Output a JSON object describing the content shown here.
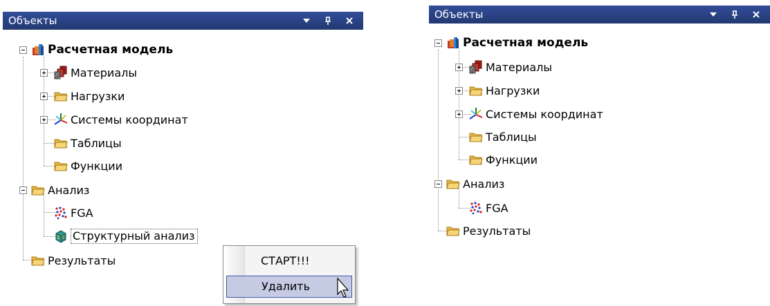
{
  "panels": [
    {
      "title": "Объекты",
      "tree": {
        "root": "Расчетная модель",
        "materials": "Материалы",
        "loads": "Нагрузки",
        "coords": "Системы координат",
        "tables": "Таблицы",
        "functions": "Функции",
        "analysis": "Анализ",
        "fga": "FGA",
        "structural": "Структурный анализ",
        "results": "Результаты"
      }
    },
    {
      "title": "Объекты",
      "tree": {
        "root": "Расчетная модель",
        "materials": "Материалы",
        "loads": "Нагрузки",
        "coords": "Системы координат",
        "tables": "Таблицы",
        "functions": "Функции",
        "analysis": "Анализ",
        "fga": "FGA",
        "results": "Результаты"
      }
    }
  ],
  "context_menu": {
    "start": "СТАРТ!!!",
    "delete": "Удалить"
  },
  "icons": {
    "dropdown": "chevron-down-icon",
    "pin": "pin-icon",
    "close": "close-icon",
    "model": "model-icon",
    "materials": "materials-icon",
    "folder": "folder-icon",
    "coords": "coordinate-axes-icon",
    "fga": "fga-icon",
    "structural": "structural-analysis-icon"
  },
  "colors": {
    "titlebar": "#2a4284",
    "menu_highlight": "#c6cbe4",
    "menu_highlight_border": "#3e57a3"
  }
}
